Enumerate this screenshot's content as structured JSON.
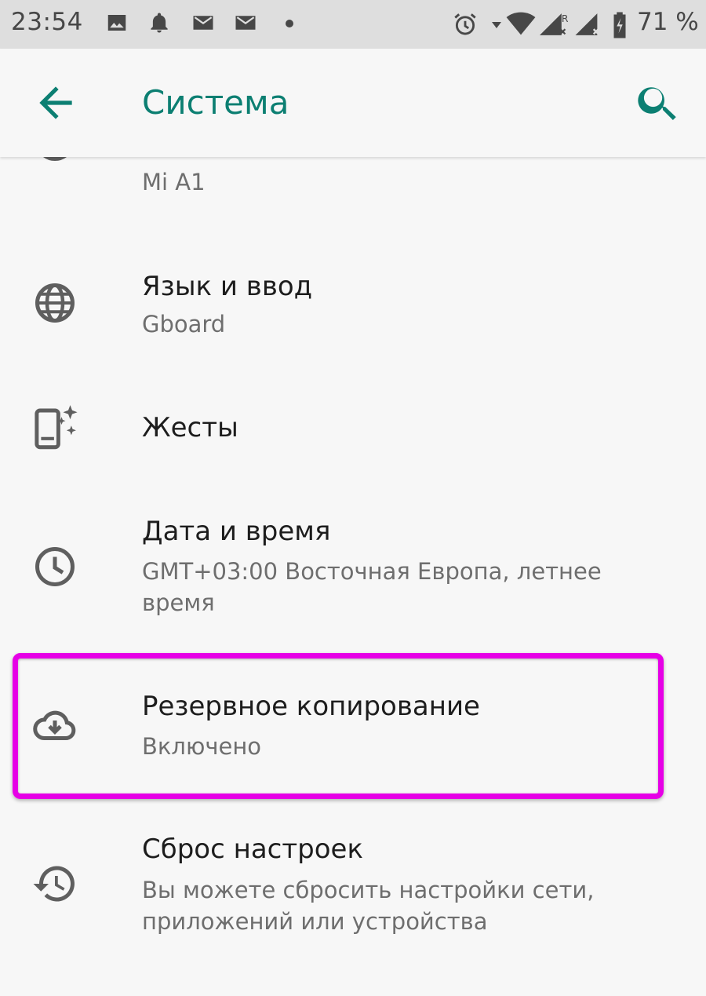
{
  "status_bar": {
    "time": "23:54",
    "battery_percent": "71 %",
    "icons": [
      "image-icon",
      "bell-icon",
      "mail-icon",
      "mail-icon",
      "dot-icon",
      "alarm-icon",
      "signal-arrow-icon",
      "wifi-icon",
      "cell-signal-roaming-icon",
      "cell-signal-icon",
      "battery-charging-icon"
    ]
  },
  "app_bar": {
    "title": "Система",
    "back_icon": "arrow-left-icon",
    "search_icon": "search-icon"
  },
  "items": [
    {
      "title": "",
      "summary": "Mi A1",
      "icon": "info-icon"
    },
    {
      "title": "Язык и ввод",
      "summary": "Gboard",
      "icon": "globe-icon"
    },
    {
      "title": "Жесты",
      "summary": "",
      "icon": "phone-gesture-icon"
    },
    {
      "title": "Дата и время",
      "summary": "GMT+03:00 Восточная Европа, летнее время",
      "icon": "clock-icon"
    },
    {
      "title": "Резервное копирование",
      "summary": "Включено",
      "icon": "cloud-backup-icon"
    },
    {
      "title": "Сброс настроек",
      "summary": "Вы можете сбросить настройки сети, приложений или устройства",
      "icon": "history-icon"
    }
  ],
  "colors": {
    "accent": "#0c7f72",
    "highlight": "#e600e6",
    "icon": "#5f5f5f"
  }
}
